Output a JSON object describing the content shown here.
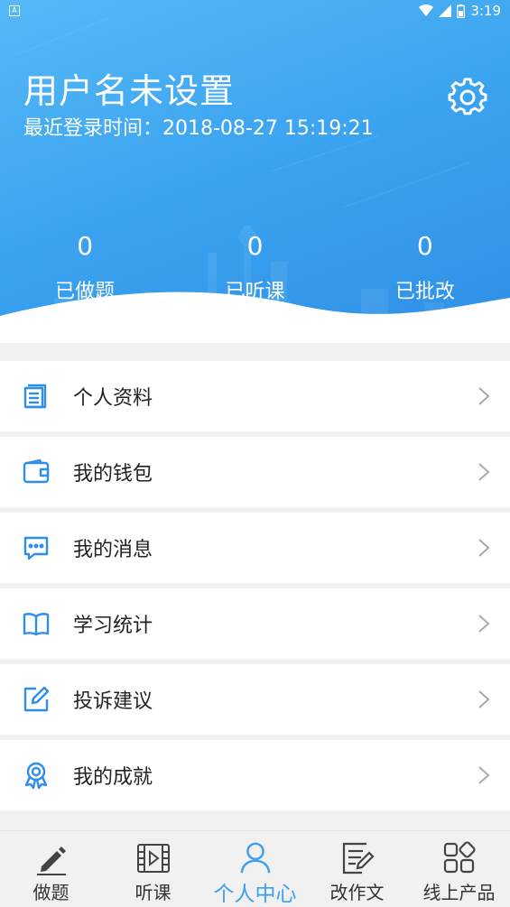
{
  "status_bar": {
    "time": "3:19",
    "notification_icon": "A"
  },
  "profile": {
    "username": "用户名未设置",
    "last_login": "最近登录时间：2018-08-27 15:19:21"
  },
  "stats": [
    {
      "value": "0",
      "label": "已做题"
    },
    {
      "value": "0",
      "label": "已听课"
    },
    {
      "value": "0",
      "label": "已批改"
    }
  ],
  "menu": [
    {
      "label": "个人资料",
      "icon": "document-icon"
    },
    {
      "label": "我的钱包",
      "icon": "wallet-icon"
    },
    {
      "label": "我的消息",
      "icon": "message-icon"
    },
    {
      "label": "学习统计",
      "icon": "book-icon"
    },
    {
      "label": "投诉建议",
      "icon": "edit-icon"
    },
    {
      "label": "我的成就",
      "icon": "medal-icon"
    }
  ],
  "tabs": [
    {
      "label": "做题",
      "icon": "pencil-icon",
      "active": false
    },
    {
      "label": "听课",
      "icon": "video-icon",
      "active": false
    },
    {
      "label": "个人中心",
      "icon": "person-icon",
      "active": true
    },
    {
      "label": "改作文",
      "icon": "essay-icon",
      "active": false
    },
    {
      "label": "线上产品",
      "icon": "grid-icon",
      "active": false
    }
  ],
  "colors": {
    "accent": "#3d9ff0",
    "icon_blue": "#2e8ee8",
    "header_gradient_start": "#56b9f7",
    "header_gradient_end": "#2f8fe6"
  }
}
